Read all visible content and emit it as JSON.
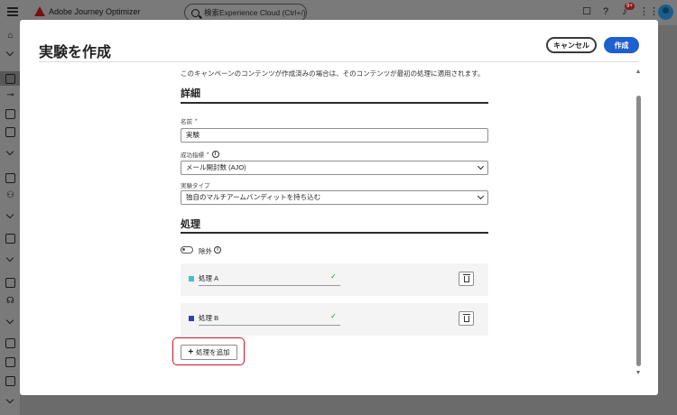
{
  "app": {
    "name": "Adobe Journey Optimizer",
    "notification_count": "9+"
  },
  "search": {
    "placeholder": "検索Experience Cloud (Ctrl+/)"
  },
  "modal": {
    "title": "実験を作成",
    "cancel_label": "キャンセル",
    "create_label": "作成",
    "intro": "このキャンペーンのコンテンツが作成済みの場合は、そのコンテンツが最初の処理に適用されます。"
  },
  "details": {
    "heading": "詳細",
    "name_label": "名前",
    "name_value": "実験",
    "metric_label": "成功指標",
    "metric_value": "メール開封数 (AJO)",
    "type_label": "実験タイプ",
    "type_value": "独自のマルチアームバンディットを持ち込む",
    "required_mark": "*"
  },
  "treatments": {
    "heading": "処理",
    "exclude_label": "除外",
    "items": [
      {
        "name": "処理 A",
        "color": "#3ec3c3"
      },
      {
        "name": "処理 B",
        "color": "#3b3bb0"
      }
    ],
    "add_label": "処理を追加"
  },
  "icons": {
    "info": "i",
    "check": "✓",
    "plus": "+"
  }
}
